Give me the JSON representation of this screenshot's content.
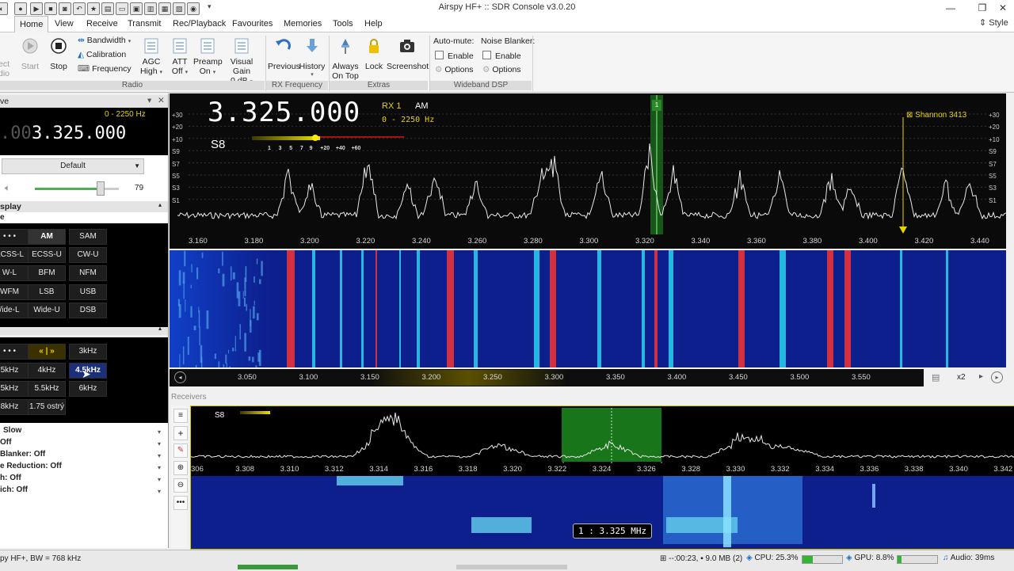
{
  "window": {
    "title": "Airspy HF+ :: SDR Console v3.0.20",
    "minimize": "—",
    "restore": "❐",
    "close": "✕",
    "style_label": "Style"
  },
  "tabs": [
    "Home",
    "View",
    "Receive",
    "Transmit",
    "Rec/Playback",
    "Favourites",
    "Memories",
    "Tools",
    "Help"
  ],
  "ribbon": {
    "left_partial_a": "ect",
    "left_partial_b": "dio",
    "start": "Start",
    "stop": "Stop",
    "bandwidth": "Bandwidth",
    "calibration": "Calibration",
    "frequency": "Frequency",
    "agc": "AGC",
    "agc_val": "High",
    "att": "ATT",
    "att_val": "Off",
    "preamp": "Preamp",
    "preamp_val": "On",
    "visual_gain": "Visual Gain",
    "visual_gain_val": "0 dB",
    "previous": "Previous",
    "history": "History",
    "always": "Always",
    "on_top": "On Top",
    "lock": "Lock",
    "screenshot": "Screenshot",
    "auto_mute": "Auto-mute:",
    "noise_blanker": "Noise Blanker:",
    "enable": "Enable",
    "options": "Options",
    "group_radio": "Radio",
    "group_rx": "RX Frequency",
    "group_extras": "Extras",
    "group_wdsp": "Wideband DSP"
  },
  "left": {
    "header": "ve",
    "range": "0 - 2250 Hz",
    "freq_dim": ".00",
    "freq": "3.325.000",
    "preset": "Default",
    "volume": "79",
    "volume_level": 0.77,
    "display_label": "splay",
    "e_label": "e",
    "modes": [
      [
        "• • •",
        "AM",
        "SAM"
      ],
      [
        "ECSS-L",
        "ECSS-U",
        "CW-U"
      ],
      [
        "W-L",
        "BFM",
        "NFM"
      ],
      [
        "WFM",
        "LSB",
        "USB"
      ],
      [
        "/ide-L",
        "Wide-U",
        "DSB"
      ]
    ],
    "bandwidths": [
      [
        "• • •",
        "« | »",
        "3kHz"
      ],
      [
        "5kHz",
        "4kHz",
        "4.5kHz"
      ],
      [
        "5kHz",
        "5.5kHz",
        "6kHz"
      ],
      [
        "8kHz",
        "1.75 ostrý",
        ""
      ]
    ],
    "options": [
      "Slow",
      "Off",
      "Blanker: Off",
      "e Reduction: Off",
      "h: Off",
      "ich: Off"
    ]
  },
  "rx_overlay": {
    "freq": "3.325.000",
    "rx": "RX 1",
    "mode": "AM",
    "range": "0 - 2250 Hz",
    "smeter": "S8",
    "smeter_scale": [
      "1",
      "3",
      "5",
      "7",
      "9",
      "+20",
      "+40",
      "+60"
    ],
    "marker_num": "1",
    "station": "⊠ Shannon 3413"
  },
  "spectrum_left_scale": [
    "+30",
    "+20",
    "+10",
    "S9",
    "S7",
    "S5",
    "S3",
    "S1"
  ],
  "spectrum_right_scale": [
    "+30",
    "+20",
    "+10",
    "S9",
    "S7",
    "S5",
    "S3",
    "S1"
  ],
  "spectrum_ticks": [
    "3.160",
    "3.180",
    "3.200",
    "3.220",
    "3.240",
    "3.260",
    "3.280",
    "3.300",
    "3.320",
    "3.340",
    "3.360",
    "3.380",
    "3.400",
    "3.420",
    "3.440"
  ],
  "waterfall_ticks": [
    "3.050",
    "3.100",
    "3.150",
    "3.200",
    "3.250",
    "3.300",
    "3.350",
    "3.400",
    "3.450",
    "3.500",
    "3.550"
  ],
  "waterfall_zoom": "x2",
  "receivers": {
    "label": "Receivers",
    "smeter": "S8",
    "ticks": [
      "306",
      "3.308",
      "3.310",
      "3.312",
      "3.314",
      "3.316",
      "3.318",
      "3.320",
      "3.322",
      "3.324",
      "3.326",
      "3.328",
      "3.330",
      "3.332",
      "3.334",
      "3.336",
      "3.338",
      "3.340",
      "3.342"
    ],
    "tooltip": "1 : 3.325 MHz"
  },
  "status": {
    "left": "py HF+, BW = 768 kHz",
    "time": "--:00:23, ",
    "mem": "9.0 MB (2)",
    "cpu": "CPU: 25.3%",
    "gpu": "GPU: 8.8%",
    "audio": "Audio: 39ms"
  },
  "colors": {
    "accent": "#1a6fc4",
    "waterfall_bg": "#0d1f8c",
    "red_signal": "#e8333a",
    "cyan_signal": "#28c8e8",
    "rx_green": "#2ec42e",
    "marker_yellow": "#e8d400"
  }
}
